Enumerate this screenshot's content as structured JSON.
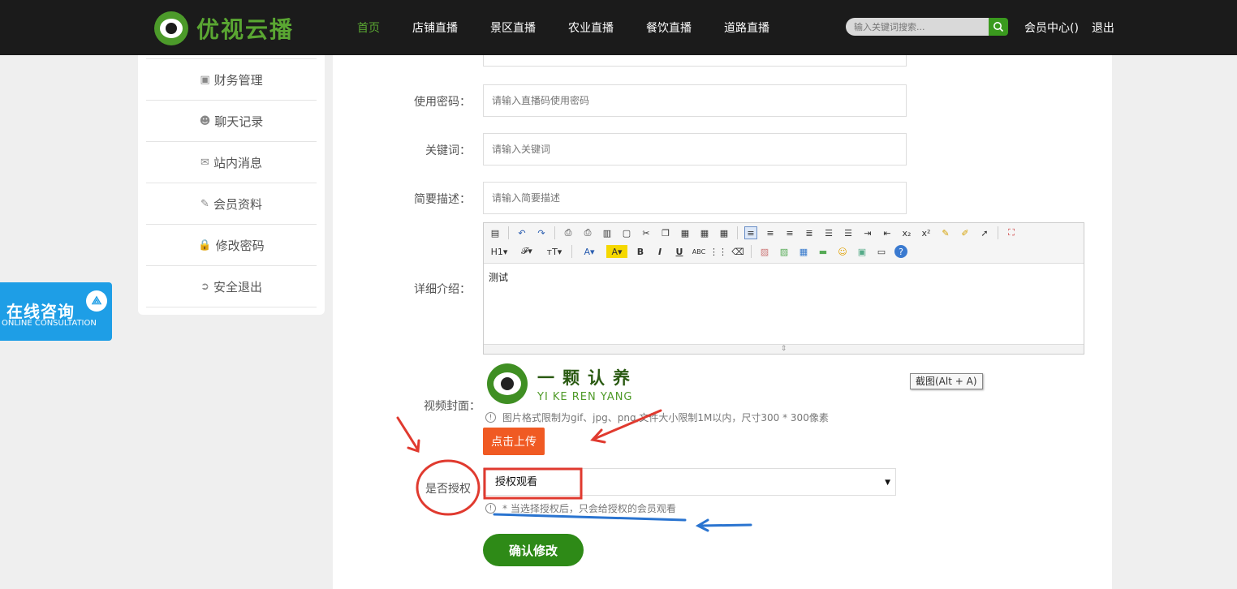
{
  "header": {
    "logo_text": "优视云播",
    "nav": [
      "首页",
      "店铺直播",
      "景区直播",
      "农业直播",
      "餐饮直播",
      "道路直播"
    ],
    "search_placeholder": "输入关键词搜索...",
    "member_center": "会员中心()",
    "logout": "退出"
  },
  "sidebar": {
    "items": [
      {
        "icon": "money-icon",
        "glyph": "▣",
        "label": "财务管理"
      },
      {
        "icon": "wechat-icon",
        "glyph": "☻",
        "label": "聊天记录"
      },
      {
        "icon": "envelope-icon",
        "glyph": "✉",
        "label": "站内消息"
      },
      {
        "icon": "edit-icon",
        "glyph": "✎",
        "label": "会员资料"
      },
      {
        "icon": "lock-icon",
        "glyph": "🔒",
        "label": "修改密码"
      },
      {
        "icon": "signout-icon",
        "glyph": "➲",
        "label": "安全退出"
      }
    ]
  },
  "consult": {
    "title": "在线咨询",
    "subtitle": "ONLINE CONSULTATION"
  },
  "form": {
    "password_label": "使用密码：",
    "password_placeholder": "请输入直播码使用密码",
    "keywords_label": "关键词：",
    "keywords_placeholder": "请输入关键词",
    "summary_label": "简要描述：",
    "summary_placeholder": "请输入简要描述",
    "detail_label": "详细介绍：",
    "detail_content": "测试",
    "cover_label": "视频封面：",
    "cover_logo_cn": "一颗认养",
    "cover_logo_en": "YI KE REN YANG",
    "cover_hint": "图片格式限制为gif、jpg、png,文件大小限制1M以内，尺寸300 * 300像素",
    "upload_button": "点击上传",
    "auth_label": "是否授权",
    "auth_selected": "授权观看",
    "auth_hint": "* 当选择授权后，只会给授权的会员观看",
    "submit_button": "确认修改"
  },
  "tooltip": "截图(Alt + A)",
  "colors": {
    "brand_green": "#5aa632",
    "upload_orange": "#f05a23",
    "annotation_red": "#e03a2f",
    "annotation_blue": "#2a74d0"
  }
}
